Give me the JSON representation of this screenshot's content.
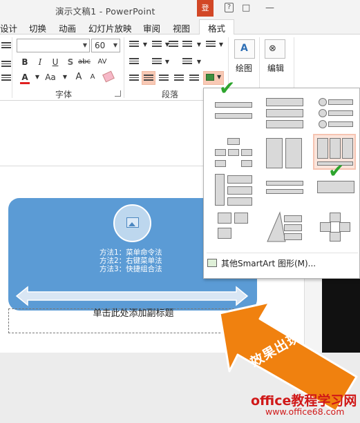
{
  "window": {
    "title": "演示文稿1 - PowerPoint",
    "help_label": "?",
    "sign_in_label": "登",
    "restore_glyph": "□",
    "minimize_glyph": "—"
  },
  "tabs": [
    {
      "label": "设计"
    },
    {
      "label": "切换"
    },
    {
      "label": "动画"
    },
    {
      "label": "幻灯片放映"
    },
    {
      "label": "审阅"
    },
    {
      "label": "视图"
    },
    {
      "label": "格式",
      "active": true
    }
  ],
  "ribbon": {
    "font_name_value": "",
    "font_size_value": "60",
    "font_group_label": "字体",
    "paragraph_group_label": "段落",
    "drawing_label": "绘图",
    "editing_label": "编辑",
    "bold": "B",
    "italic": "I",
    "underline": "U",
    "shadow": "S",
    "strikethrough": "abc",
    "spacing": "AV",
    "font_color_letter": "A",
    "change_case": "Aa",
    "grow_font": "A",
    "shrink_font": "A"
  },
  "slide": {
    "smartart_lines": [
      "方法1：菜单命令法",
      "方法2：右键菜单法",
      "方法3：快捷组合法"
    ],
    "subtitle_placeholder": "单击此处添加副标题"
  },
  "gallery": {
    "more_label": "其他SmartArt 图形(M)..."
  },
  "annotation": {
    "callout_text": "效果出现",
    "arrow_color": "#f0810f"
  },
  "watermark": {
    "title": "office教程学习网",
    "url": "www.office68.com"
  },
  "colors": {
    "smartart_fill": "#5b9bd5",
    "selected_highlight": "#f8c9b5",
    "check_green": "#2ea52e",
    "font_color_bar": "#e02020"
  }
}
